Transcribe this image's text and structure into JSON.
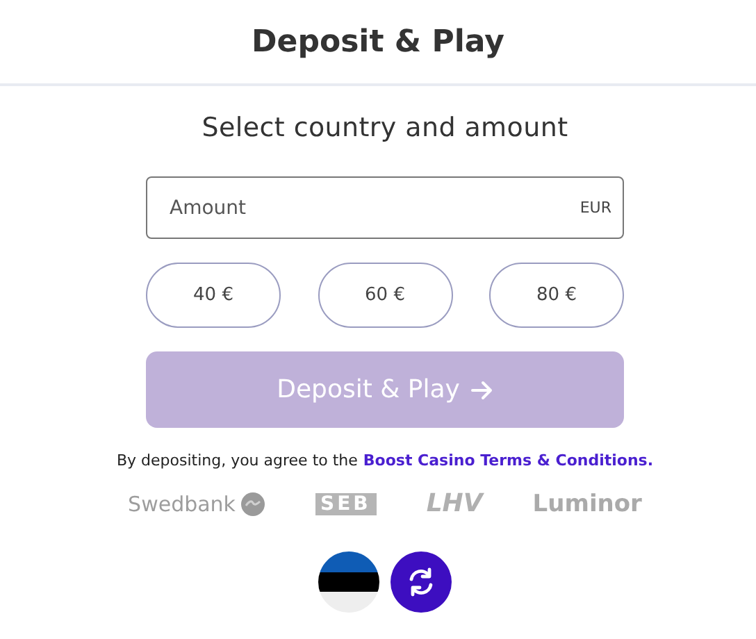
{
  "header": {
    "title": "Deposit & Play"
  },
  "subtitle": "Select country and amount",
  "amount_field": {
    "placeholder": "Amount",
    "currency": "EUR"
  },
  "presets": [
    {
      "label": "40 €",
      "selected": false
    },
    {
      "label": "60 €",
      "selected": false
    },
    {
      "label": "80 €",
      "selected": false
    }
  ],
  "deposit_button": {
    "label": "Deposit & Play",
    "disabled": true
  },
  "terms": {
    "text": "By depositing, you agree to the",
    "link": "Boost Casino Terms & Conditions."
  },
  "banks": [
    {
      "name": "Swedbank",
      "kind": "swedbank"
    },
    {
      "name": "SEB",
      "kind": "seb"
    },
    {
      "name": "LHV",
      "kind": "lhv"
    },
    {
      "name": "Luminor",
      "kind": "luminor"
    }
  ]
}
